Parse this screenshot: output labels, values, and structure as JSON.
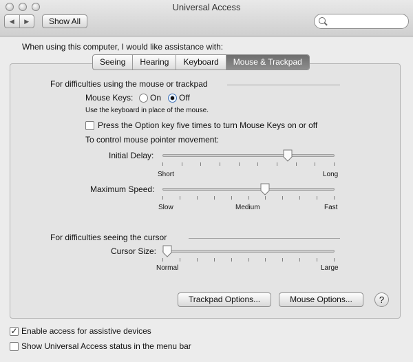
{
  "window": {
    "title": "Universal Access"
  },
  "toolbar": {
    "back_icon": "back-arrow",
    "forward_icon": "forward-arrow",
    "show_all_label": "Show All",
    "search_placeholder": ""
  },
  "prompt": "When using this computer, I would like assistance with:",
  "tabs": [
    {
      "label": "Seeing",
      "active": false
    },
    {
      "label": "Hearing",
      "active": false
    },
    {
      "label": "Keyboard",
      "active": false
    },
    {
      "label": "Mouse & Trackpad",
      "active": true
    }
  ],
  "mouse_section": {
    "title": "For difficulties using the mouse or trackpad",
    "mouse_keys_label": "Mouse Keys:",
    "on_label": "On",
    "off_label": "Off",
    "selected": "Off",
    "keyboard_hint": "Use the keyboard in place of the mouse.",
    "option_key_label": "Press the Option key five times to turn Mouse Keys on or off",
    "option_key_checked": false,
    "pointer_heading": "To control mouse pointer movement:",
    "initial_delay": {
      "label": "Initial Delay:",
      "min_label": "Short",
      "max_label": "Long",
      "value": 0.74
    },
    "max_speed": {
      "label": "Maximum Speed:",
      "min_label": "Slow",
      "mid_label": "Medium",
      "max_label": "Fast",
      "value": 0.6
    }
  },
  "cursor_section": {
    "title": "For difficulties seeing the cursor",
    "cursor_size": {
      "label": "Cursor Size:",
      "min_label": "Normal",
      "max_label": "Large",
      "value": 0.0
    }
  },
  "buttons": {
    "trackpad_options": "Trackpad Options...",
    "mouse_options": "Mouse Options...",
    "help": "?"
  },
  "footer": {
    "assistive_label": "Enable access for assistive devices",
    "assistive_checked": true,
    "status_label": "Show Universal Access status in the menu bar",
    "status_checked": false
  },
  "colors": {
    "active_tab": "#7a7a7a",
    "radio_selected": "#3b6fb6"
  }
}
